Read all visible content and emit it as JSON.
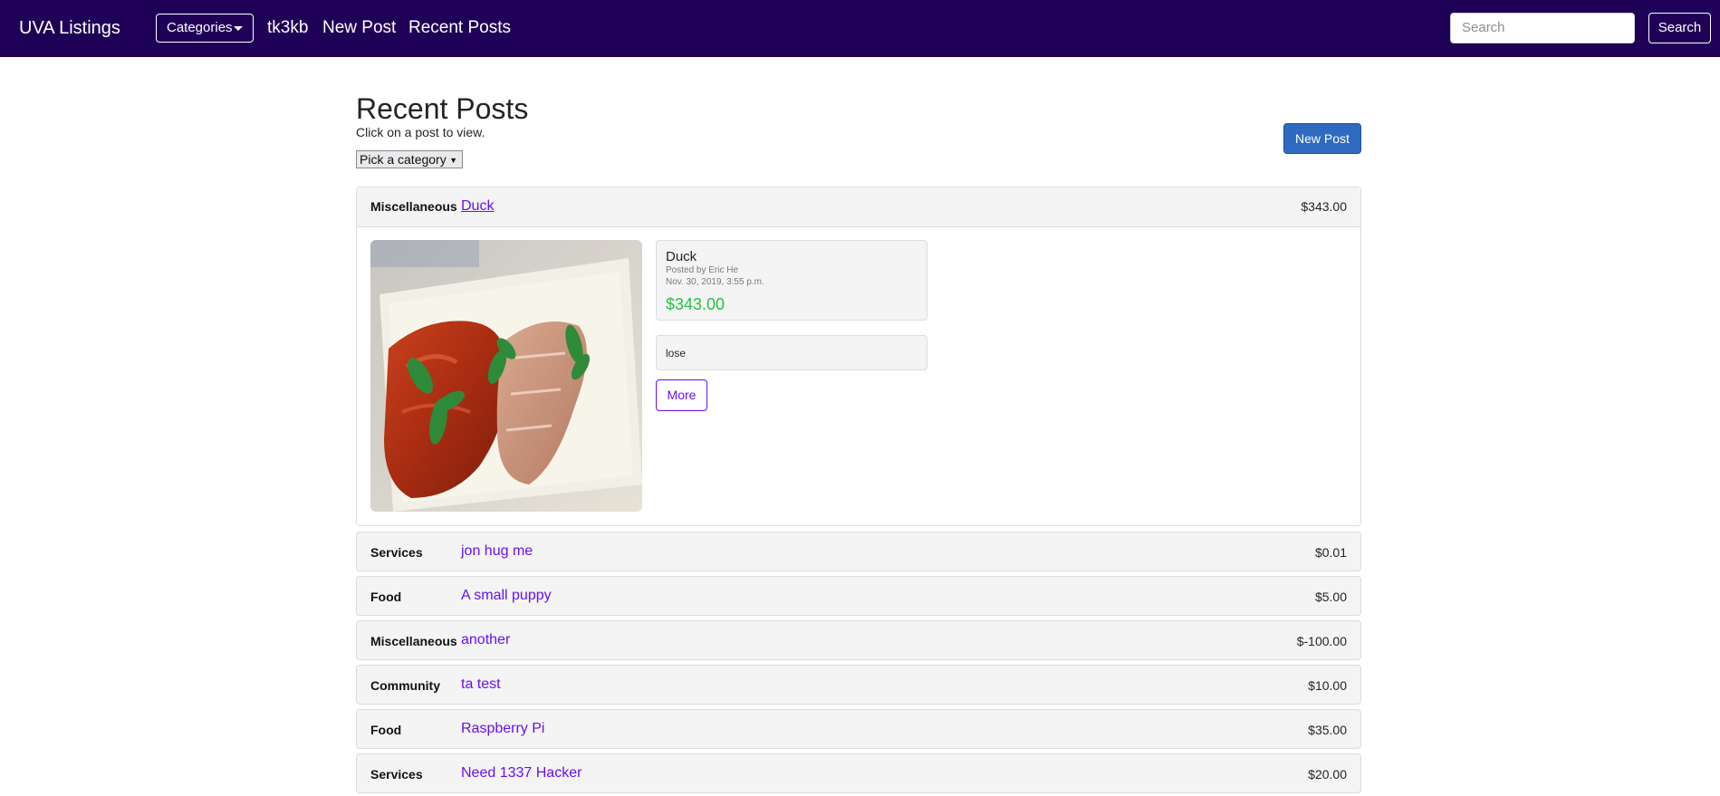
{
  "navbar": {
    "brand": "UVA Listings",
    "categories_label": "Categories",
    "links": [
      "tk3kb",
      "New Post",
      "Recent Posts"
    ],
    "search_placeholder": "Search",
    "search_button": "Search",
    "background_color": "#1f0057"
  },
  "page": {
    "title": "Recent Posts",
    "subtitle": "Click on a post to view.",
    "category_select": "Pick a category",
    "new_post_button": "New Post"
  },
  "expanded_post": {
    "category": "Miscellaneous",
    "title": "Duck",
    "price": "$343.00",
    "detail": {
      "title": "Duck",
      "author": "Posted by Eric He",
      "date": "Nov. 30, 2019, 3:55 p.m.",
      "price": "$343.00",
      "description": "lose",
      "more_button": "More"
    },
    "image": "roast-duck-photo"
  },
  "posts": [
    {
      "category": "Services",
      "title": "jon hug me",
      "price": "$0.01"
    },
    {
      "category": "Food",
      "title": "A small puppy",
      "price": "$5.00"
    },
    {
      "category": "Miscellaneous",
      "title": "another",
      "price": "$-100.00"
    },
    {
      "category": "Community",
      "title": "ta test",
      "price": "$10.00"
    },
    {
      "category": "Food",
      "title": "Raspberry Pi",
      "price": "$35.00"
    },
    {
      "category": "Services",
      "title": "Need 1337 Hacker",
      "price": "$20.00"
    }
  ],
  "colors": {
    "link": "#6610f2",
    "primary_button": "#2e6bc0",
    "price_green": "#27c245"
  }
}
